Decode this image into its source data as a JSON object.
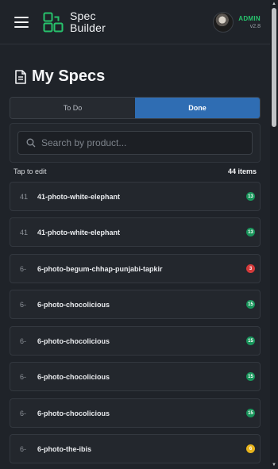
{
  "header": {
    "app_name_line1": "Spec",
    "app_name_line2": "Builder",
    "user_role": "ADMIN",
    "version": "v2.8",
    "accent": "#27c26c"
  },
  "page": {
    "title": "My Specs"
  },
  "tabs": [
    {
      "label": "To Do",
      "active": false
    },
    {
      "label": "Done",
      "active": true
    }
  ],
  "search": {
    "placeholder": "Search by product..."
  },
  "list": {
    "hint": "Tap to edit",
    "count": "44 items",
    "items": [
      {
        "num": "41",
        "name": "41-photo-white-elephant",
        "badge": "13",
        "badge_color": "#18945a"
      },
      {
        "num": "41",
        "name": "41-photo-white-elephant",
        "badge": "13",
        "badge_color": "#18945a"
      },
      {
        "num": "6-",
        "name": "6-photo-begum-chhap-punjabi-tapkir",
        "badge": "3",
        "badge_color": "#d43a3a"
      },
      {
        "num": "6-",
        "name": "6-photo-chocolicious",
        "badge": "15",
        "badge_color": "#18945a"
      },
      {
        "num": "6-",
        "name": "6-photo-chocolicious",
        "badge": "15",
        "badge_color": "#18945a"
      },
      {
        "num": "6-",
        "name": "6-photo-chocolicious",
        "badge": "15",
        "badge_color": "#18945a"
      },
      {
        "num": "6-",
        "name": "6-photo-chocolicious",
        "badge": "15",
        "badge_color": "#18945a"
      },
      {
        "num": "6-",
        "name": "6-photo-the-ibis",
        "badge": "6",
        "badge_color": "#e8b41c"
      }
    ]
  }
}
